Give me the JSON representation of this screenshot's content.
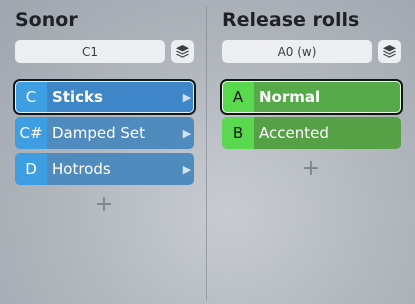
{
  "left_panel": {
    "title": "Sonor",
    "selector_value": "C1",
    "layers_icon": "layers-icon",
    "items": [
      {
        "key": "C",
        "label": "Sticks",
        "selected": true
      },
      {
        "key": "C#",
        "label": "Damped Set",
        "selected": false
      },
      {
        "key": "D",
        "label": "Hotrods",
        "selected": false
      }
    ],
    "add_label": "+",
    "accent": "#3d9fe2"
  },
  "right_panel": {
    "title": "Release rolls",
    "selector_value": "A0 (w)",
    "layers_icon": "layers-icon",
    "items": [
      {
        "key": "A",
        "label": "Normal",
        "selected": true
      },
      {
        "key": "B",
        "label": "Accented",
        "selected": false
      }
    ],
    "add_label": "+",
    "accent": "#5ad84e"
  }
}
